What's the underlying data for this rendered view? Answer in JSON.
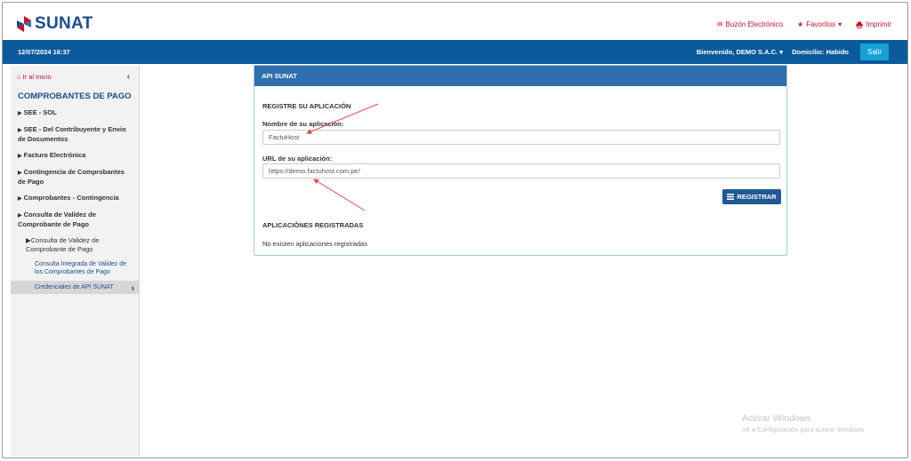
{
  "header": {
    "logo_text": "SUNAT",
    "links": [
      {
        "icon": "envelope-icon",
        "label": "Buzón Electrónico"
      },
      {
        "icon": "star-icon",
        "label": "Favoritos"
      },
      {
        "icon": "printer-icon",
        "label": "Imprimir"
      }
    ]
  },
  "bluebar": {
    "datetime": "12/07/2024 16:37",
    "welcome": "Bienvenido, DEMO S.A.C.",
    "domicilio": "Domicilio: Habido",
    "logout_label": "Salir"
  },
  "sidebar": {
    "home_label": "Ir al Inicio",
    "title": "COMPROBANTES DE PAGO",
    "items": [
      "SEE - SOL",
      "SEE - Del Contribuyente y Envio de Documentos",
      "Factura Electrónica",
      "Contingencia de Comprobantes de Pago",
      "Comprobantes - Contingencia",
      "Consulta de Validez de Comprobante de Pago"
    ],
    "subitem": "Consulta de Validez de Comprobante de Pago",
    "leaf_items": [
      "Consulta Integrada de Validez de los Comprobantes de Pago",
      "Credenciales de API SUNAT"
    ]
  },
  "panel": {
    "title": "API SUNAT",
    "register_heading": "REGISTRE SU APLICACIÓN",
    "name_label": "Nombre de su aplicación:",
    "name_value": "FactuHost",
    "url_label": "URL de su aplicación:",
    "url_value": "https://demo.factuhost.com.pe/",
    "register_button": "REGISTRAR",
    "registered_heading": "APLICACIÓNES REGISTRADAS",
    "empty_message": "No existen aplicaciones registradas"
  },
  "watermark": {
    "title": "Activar Windows",
    "subtitle": "Ve a Configuración para activar Windows"
  },
  "colors": {
    "brand_blue": "#0a5a9c",
    "accent_red": "#c8102e",
    "panel_header": "#2f6fb0",
    "button_blue": "#1f5a94",
    "logout_button": "#17a2d6"
  }
}
